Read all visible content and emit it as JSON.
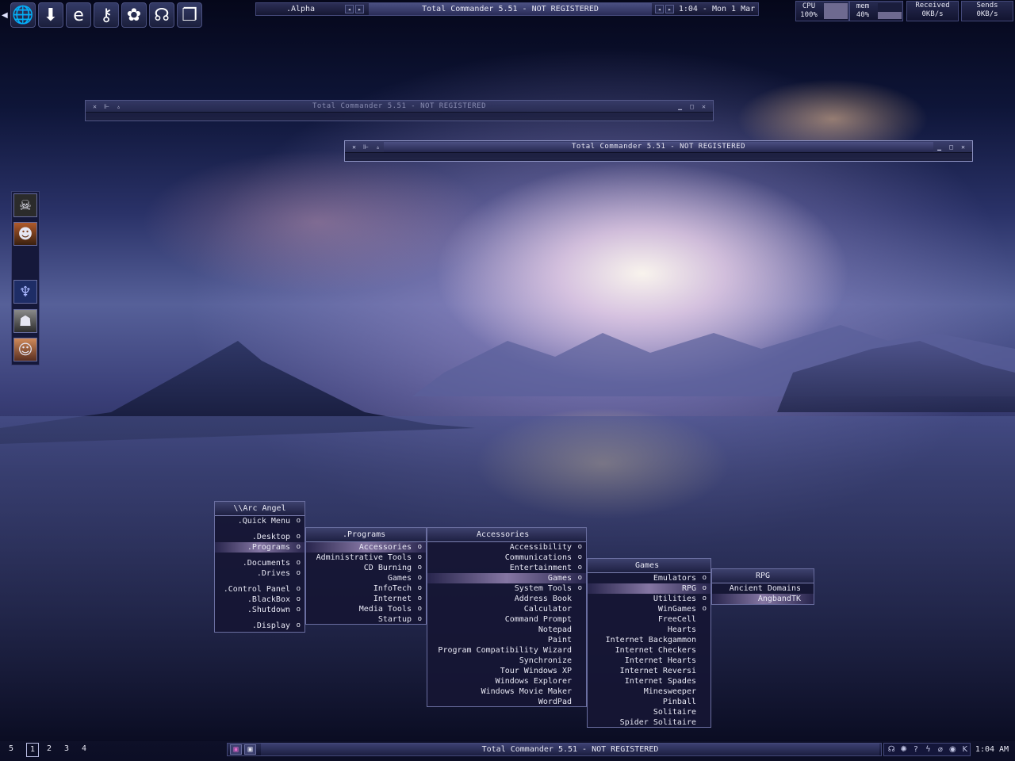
{
  "desktop": {
    "wallpaper": "sunset-over-lake-mountains"
  },
  "quicklaunch": {
    "arrow_icon": "left-arrow-icon",
    "icons": [
      "globe-icon",
      "download-arrow-icon",
      "internet-explorer-icon",
      "keys-icon",
      "lotus-icon",
      "headphones-icon",
      "folder-icon"
    ]
  },
  "toolbar": {
    "workspace": ".Alpha",
    "title": "Total Commander 5.51 - NOT REGISTERED",
    "clock": "1:04 - Mon 1 Mar"
  },
  "stats": {
    "cpu_label": "CPU",
    "cpu_value": "100%",
    "mem_label": "mem",
    "mem_value": "40%",
    "recv_label": "Received",
    "recv_value": "0KB/s",
    "send_label": "Sends",
    "send_value": "0KB/s"
  },
  "windows": [
    {
      "title": "Total Commander 5.51 - NOT REGISTERED"
    },
    {
      "title": "Total Commander 5.51 - NOT REGISTERED"
    }
  ],
  "side_icons": [
    "skull-icon",
    "warrior-face-icon",
    "bat-emblem-icon",
    "robot-head-icon",
    "girl-portrait-icon"
  ],
  "menus": {
    "root": {
      "title": "\\\\Arc Angel",
      "items": [
        ".Quick Menu",
        ".Desktop",
        ".Programs",
        ".Documents",
        ".Drives",
        ".Control Panel",
        ".BlackBox",
        ".Shutdown",
        ".Display"
      ]
    },
    "programs": {
      "title": ".Programs",
      "items": [
        "Accessories",
        "Administrative Tools",
        "CD Burning",
        "Games",
        "InfoTech",
        "Internet",
        "Media Tools",
        "Startup"
      ]
    },
    "accessories": {
      "title": "Accessories",
      "items": [
        "Accessibility",
        "Communications",
        "Entertainment",
        "Games",
        "System Tools",
        "Address Book",
        "Calculator",
        "Command Prompt",
        "Notepad",
        "Paint",
        "Program Compatibility Wizard",
        "Synchronize",
        "Tour Windows XP",
        "Windows Explorer",
        "Windows Movie Maker",
        "WordPad"
      ]
    },
    "games": {
      "title": "Games",
      "items": [
        "Emulators",
        "RPG",
        "Utilities",
        "WinGames",
        "FreeCell",
        "Hearts",
        "Internet Backgammon",
        "Internet Checkers",
        "Internet Hearts",
        "Internet Reversi",
        "Internet Spades",
        "Minesweeper",
        "Pinball",
        "Solitaire",
        "Spider Solitaire"
      ]
    },
    "rpg": {
      "title": "RPG",
      "items": [
        "Ancient Domains",
        "AngbandTK"
      ]
    }
  },
  "bottombar": {
    "workspaces": [
      "5",
      "1",
      "2",
      "3",
      "4"
    ],
    "task_title": "Total Commander 5.51 - NOT REGISTERED",
    "tray_icons": [
      "headphones-icon",
      "sun-icon",
      "help-icon",
      "winamp-icon",
      "bottle-icon",
      "eye-icon",
      "k-icon"
    ],
    "clock": "1:04 AM"
  }
}
